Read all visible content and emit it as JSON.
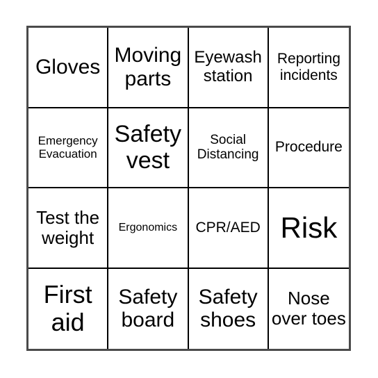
{
  "card": {
    "type": "bingo-card",
    "rows": 4,
    "columns": 4,
    "border_color": "#4a4a4a",
    "grid_line_color": "#000000",
    "background_color": "#ffffff",
    "text_color": "#000000",
    "cells": [
      {
        "text": "Gloves",
        "size": "sz-md"
      },
      {
        "text": "Moving parts",
        "size": "sz-md"
      },
      {
        "text": "Eyewash station",
        "size": "sz-xs"
      },
      {
        "text": "Reporting incidents",
        "size": "sz-xxs"
      },
      {
        "text": "Emergency Evacuation",
        "size": "sz-4xs"
      },
      {
        "text": "Safety vest",
        "size": "sz-lg"
      },
      {
        "text": "Social Distancing",
        "size": "sz-3xs"
      },
      {
        "text": "Procedure",
        "size": "sz-xxs"
      },
      {
        "text": "Test the weight",
        "size": "sz-sm"
      },
      {
        "text": "Ergonomics",
        "size": "sz-5xs"
      },
      {
        "text": "CPR/AED",
        "size": "sz-xxs"
      },
      {
        "text": "Risk",
        "size": "sz-xxl"
      },
      {
        "text": "First aid",
        "size": "sz-xl"
      },
      {
        "text": "Safety board",
        "size": "sz-md"
      },
      {
        "text": "Safety shoes",
        "size": "sz-md"
      },
      {
        "text": "Nose over toes",
        "size": "sz-sm"
      }
    ]
  }
}
